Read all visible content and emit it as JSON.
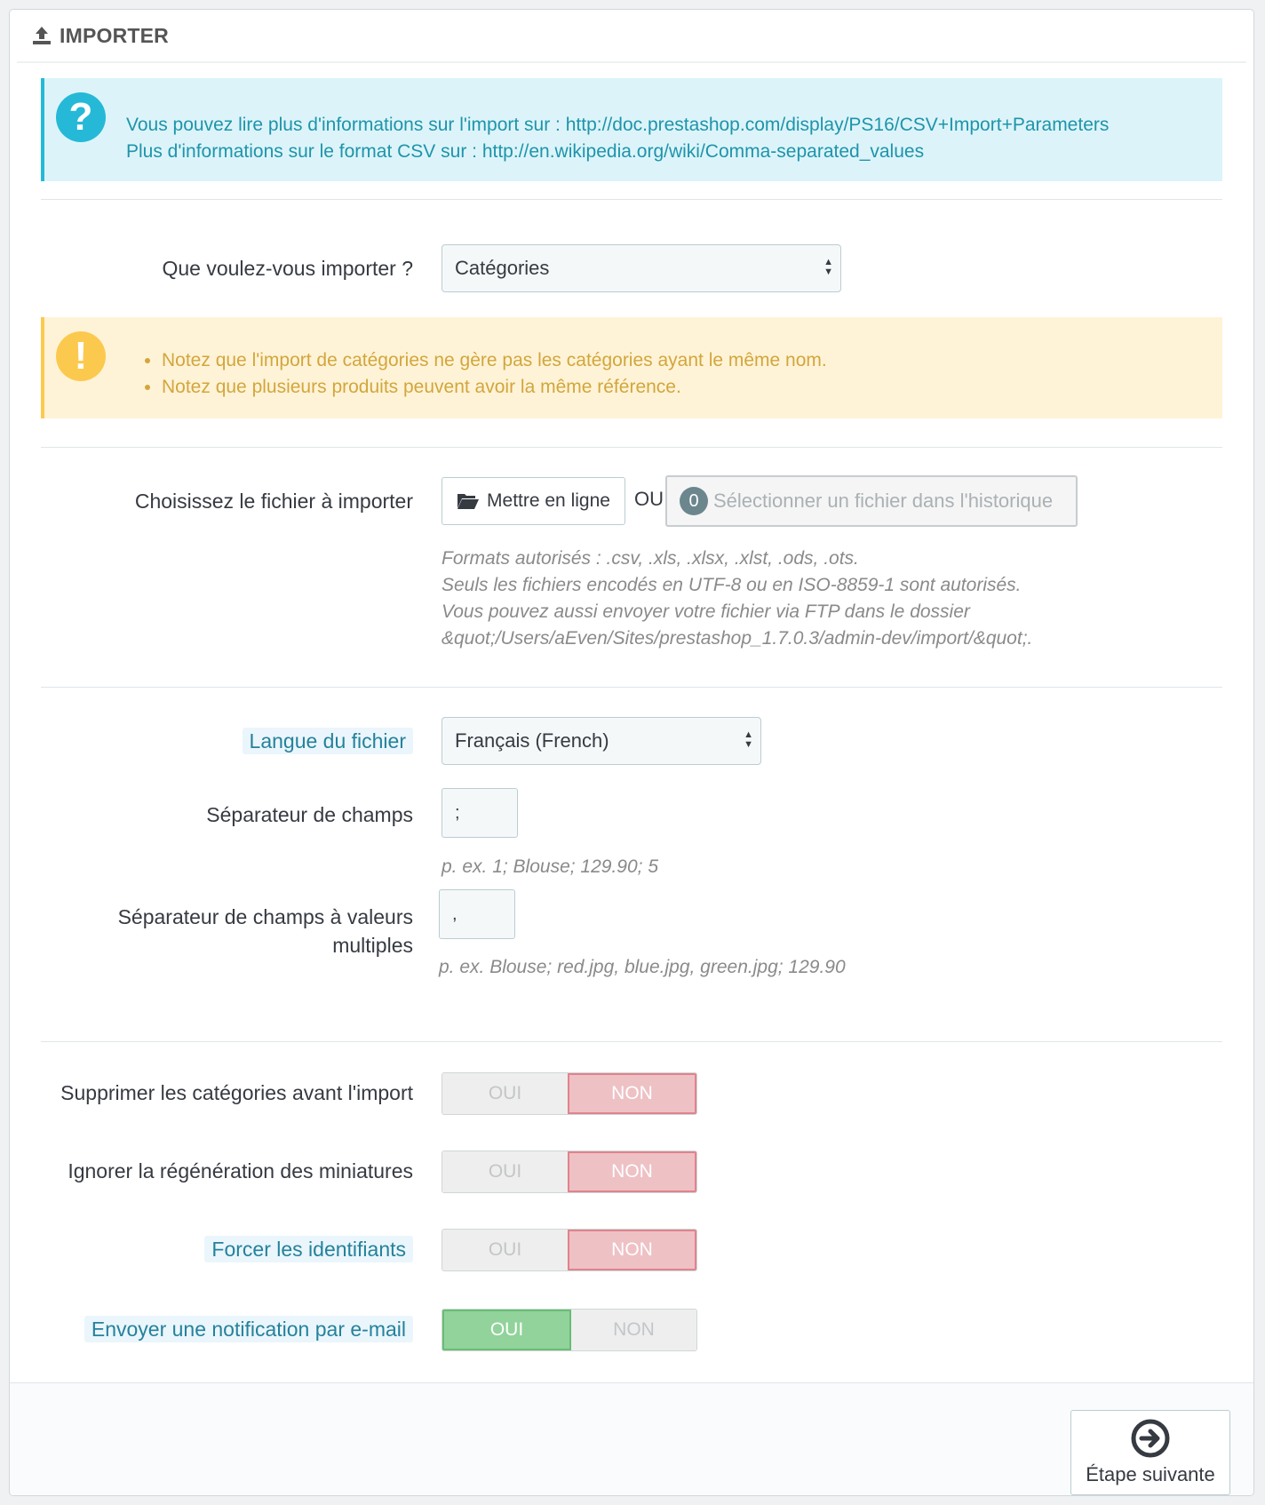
{
  "panel": {
    "title": "IMPORTER",
    "icon": "upload-icon"
  },
  "info": {
    "line1_text": "Vous pouvez lire plus d'informations sur l'import sur : ",
    "line1_link": "http://doc.prestashop.com/display/PS16/CSV+Import+Parameters",
    "line2_text": "Plus d'informations sur le format CSV sur : ",
    "line2_link": "http://en.wikipedia.org/wiki/Comma-separated_values",
    "icon": "question-icon"
  },
  "import_type": {
    "label": "Que voulez-vous importer ?",
    "value": "Catégories"
  },
  "warning": {
    "icon": "exclamation-icon",
    "items": [
      "Notez que l'import de catégories ne gère pas les catégories ayant le même nom.",
      "Notez que plusieurs produits peuvent avoir la même référence."
    ]
  },
  "file": {
    "label": "Choisissez le fichier à importer",
    "upload_label": "Mettre en ligne",
    "or_label": "OU",
    "history_count": "0",
    "history_label": "Sélectionner un fichier dans l'historique",
    "help": [
      "Formats autorisés : .csv, .xls, .xlsx, .xlst, .ods, .ots.",
      "Seuls les fichiers encodés en UTF-8 ou en ISO-8859-1 sont autorisés.",
      "Vous pouvez aussi envoyer votre fichier via FTP dans le dossier",
      "&quot;/Users/aEven/Sites/prestashop_1.7.0.3/admin-dev/import/&quot;."
    ]
  },
  "language": {
    "label": "Langue du fichier",
    "value": "Français (French)"
  },
  "field_sep": {
    "label": "Séparateur de champs",
    "value": ";",
    "help": "p. ex. 1; Blouse; 129.90; 5"
  },
  "multi_sep": {
    "label_line1": "Séparateur de champs à valeurs",
    "label_line2": "multiples",
    "value": ",",
    "help": "p. ex. Blouse; red.jpg, blue.jpg, green.jpg; 129.90"
  },
  "switches": [
    {
      "label": "Supprimer les catégories avant l'import",
      "oui": "OUI",
      "non": "NON",
      "value": "NON"
    },
    {
      "label": "Ignorer la régénération des miniatures",
      "oui": "OUI",
      "non": "NON",
      "value": "NON"
    },
    {
      "label": "Forcer les identifiants",
      "oui": "OUI",
      "non": "NON",
      "value": "NON"
    },
    {
      "label": "Envoyer une notification par e-mail",
      "oui": "OUI",
      "non": "NON",
      "value": "OUI"
    }
  ],
  "footer": {
    "next_label": "Étape suivante",
    "icon": "arrow-right-circle-icon"
  },
  "colors": {
    "info": "#25b9d7",
    "warning": "#fcc94f",
    "danger_light": "#eec1c5",
    "success_light": "#91d39b"
  }
}
